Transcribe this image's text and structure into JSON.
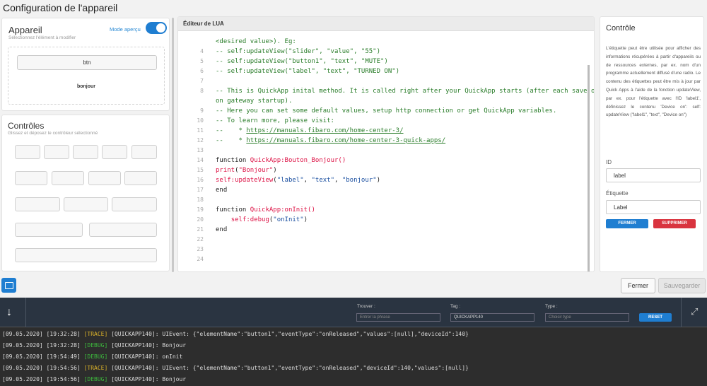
{
  "page": {
    "title": "Configuration de l'appareil"
  },
  "device": {
    "heading": "Appareil",
    "sub": "Sélectionnez l'élément à modifier",
    "mode_label": "Mode aperçu",
    "btn_label": "btn",
    "label_text": "bonjour"
  },
  "controls": {
    "heading": "Contrôles",
    "sub": "Glissez et déposez le contrôleur sélectionné"
  },
  "editor": {
    "title": "Éditeur de LUA",
    "lines": [
      {
        "n": "",
        "html": "<span class=\"cm\">&lt;desired value&gt;). Eg:</span>"
      },
      {
        "n": "4",
        "html": "<span class=\"cm\">-- self:updateView(\"slider\", \"value\", \"55\")</span>"
      },
      {
        "n": "5",
        "html": "<span class=\"cm\">-- self:updateView(\"button1\", \"text\", \"MUTE\")</span>"
      },
      {
        "n": "6",
        "html": "<span class=\"cm\">-- self:updateView(\"label\", \"text\", \"TURNED ON\")</span>"
      },
      {
        "n": "7",
        "html": ""
      },
      {
        "n": "8",
        "html": "<span class=\"cm\">-- This is QuickApp inital method. It is called right after your QuickApp starts (after each save or</span>"
      },
      {
        "n": "",
        "html": "<span class=\"cm\">on gateway startup).</span>"
      },
      {
        "n": "9",
        "html": "<span class=\"cm\">-- Here you can set some default values, setup http connection or get QuickApp variables.</span>"
      },
      {
        "n": "10",
        "html": "<span class=\"cm\">-- To learn more, please visit:</span>"
      },
      {
        "n": "11",
        "html": "<span class=\"cm\">--    * </span><span class=\"lk\">https://manuals.fibaro.com/home-center-3/</span>"
      },
      {
        "n": "12",
        "html": "<span class=\"cm\">--    * </span><span class=\"lk\">https://manuals.fibaro.com/home-center-3-quick-apps/</span>"
      },
      {
        "n": "13",
        "html": ""
      },
      {
        "n": "14",
        "html": "function <span class=\"fn\">QuickApp:Bouton_Bonjour()</span>"
      },
      {
        "n": "15",
        "html": "<span class=\"fn\">print</span>(<span class=\"fn\">\"Bonjour\"</span>)"
      },
      {
        "n": "16",
        "html": "<span class=\"fn\">self:updateView</span>(<span class=\"st\">\"label\"</span>, <span class=\"st\">\"text\"</span>, <span class=\"st\">\"bonjour\"</span>)"
      },
      {
        "n": "17",
        "html": "end"
      },
      {
        "n": "18",
        "html": ""
      },
      {
        "n": "19",
        "html": "function <span class=\"fn\">QuickApp:onInit()</span>"
      },
      {
        "n": "20",
        "html": "    <span class=\"fn\">self:debug</span>(<span class=\"st\">\"onInit\"</span>)"
      },
      {
        "n": "21",
        "html": "end"
      },
      {
        "n": "22",
        "html": ""
      },
      {
        "n": "23",
        "html": ""
      },
      {
        "n": "24",
        "html": ""
      }
    ]
  },
  "control_panel": {
    "heading": "Contrôle",
    "description": "L'étiquette peut être utilisée pour afficher des informations récupérées à partir d'appareils ou de ressources externes, par ex. nom d'un programme actuellement diffusé d'une radio. Le contenu des étiquettes peut être mis à jour par Quick Apps à l'aide de la fonction updateView, par ex. pour l'étiquette avec l'ID 'label1', définissez le contenu 'Device on': self: updateView (\"label1\", \"text\", \"Device on\")",
    "id_label": "ID",
    "id_value": "label",
    "etiquette_label": "Étiquette",
    "etiquette_value": "Label",
    "close_btn": "FERMER",
    "delete_btn": "SUPPRIMER"
  },
  "footer": {
    "fermer": "Fermer",
    "sauvegarder": "Sauvegarder"
  },
  "console": {
    "search_label": "Trouver :",
    "search_placeholder": "Entrer la phrase",
    "tag_label": "Tag :",
    "tag_value": "QUICKAPP140",
    "type_label": "Type :",
    "type_placeholder": "Choisir type",
    "reset": "RESET",
    "logs": [
      {
        "ts": "[09.05.2020] [19:32:28]",
        "level": "TRACE",
        "src": "[QUICKAPP140]:",
        "msg": "UIEvent: {\"elementName\":\"button1\",\"eventType\":\"onReleased\",\"values\":[null],\"deviceId\":140}"
      },
      {
        "ts": "[09.05.2020] [19:32:28]",
        "level": "DEBUG",
        "src": "[QUICKAPP140]:",
        "msg": "Bonjour"
      },
      {
        "ts": "[09.05.2020] [19:54:49]",
        "level": "DEBUG",
        "src": "[QUICKAPP140]:",
        "msg": "onInit"
      },
      {
        "ts": "[09.05.2020] [19:54:56]",
        "level": "TRACE",
        "src": "[QUICKAPP140]:",
        "msg": "UIEvent: {\"elementName\":\"button1\",\"eventType\":\"onReleased\",\"deviceId\":140,\"values\":[null]}"
      },
      {
        "ts": "[09.05.2020] [19:54:56]",
        "level": "DEBUG",
        "src": "[QUICKAPP140]:",
        "msg": "Bonjour"
      }
    ]
  }
}
